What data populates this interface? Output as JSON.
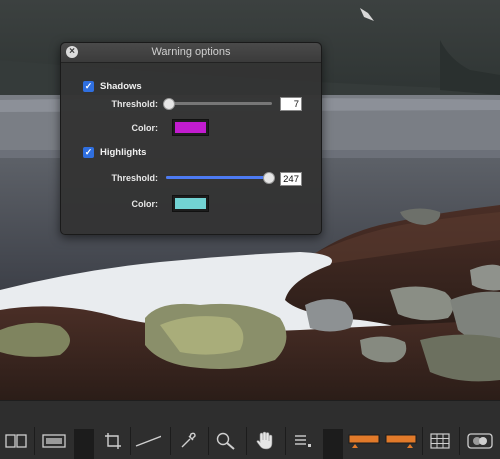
{
  "panel": {
    "title": "Warning options",
    "shadows": {
      "label": "Shadows",
      "checked": true,
      "threshold_label": "Threshold:",
      "threshold_value": "7",
      "threshold_fraction": 0.03,
      "color_label": "Color:",
      "color": "#c21ccf"
    },
    "highlights": {
      "label": "Highlights",
      "checked": true,
      "threshold_label": "Threshold:",
      "threshold_value": "247",
      "threshold_fraction": 0.97,
      "color_label": "Color:",
      "color": "#72d3d3"
    }
  },
  "toolbar": {
    "tools": [
      {
        "name": "compare-view-icon"
      },
      {
        "name": "single-view-icon"
      },
      {
        "name": "crop-icon"
      },
      {
        "name": "straighten-icon"
      },
      {
        "name": "eyedropper-icon"
      },
      {
        "name": "zoom-icon"
      },
      {
        "name": "hand-pan-icon"
      },
      {
        "name": "list-icon"
      },
      {
        "name": "shadow-warning-icon",
        "active": true
      },
      {
        "name": "highlight-warning-icon",
        "active": true
      },
      {
        "name": "grid-icon"
      },
      {
        "name": "mask-toggle-icon"
      }
    ],
    "accent_color": "#e27a2a"
  }
}
